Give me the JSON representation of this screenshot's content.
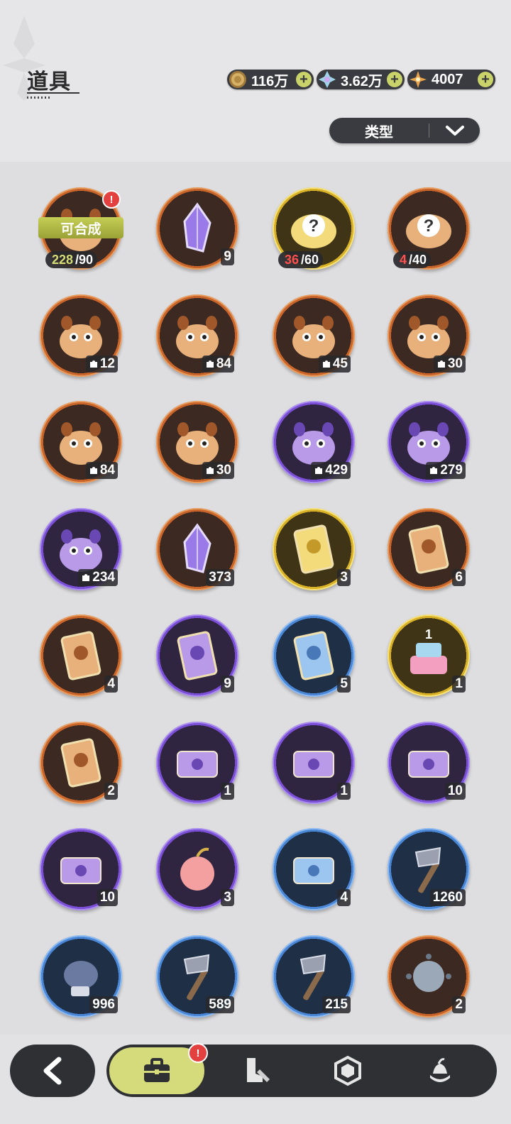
{
  "header": {
    "title": "道具",
    "currencies": [
      {
        "icon": "gold-coin-icon",
        "value": "116万"
      },
      {
        "icon": "crystal-icon",
        "value": "3.62万"
      },
      {
        "icon": "star-gem-icon",
        "value": "4007"
      }
    ],
    "plus_label": "+",
    "filter_label": "类型"
  },
  "items": [
    {
      "icon": "creature-fragment-icon",
      "rarity": "orange",
      "fragment_have": "228",
      "fragment_need": "/90",
      "have_status": "ok",
      "craft_label": "可合成",
      "alert": "!"
    },
    {
      "icon": "purple-crystal-icon",
      "rarity": "orange",
      "count": "9"
    },
    {
      "icon": "mystery-fragment-icon",
      "rarity": "gold",
      "fragment_have": "36",
      "fragment_need": "/60",
      "have_status": "low"
    },
    {
      "icon": "mystery-fragment-icon",
      "rarity": "orange",
      "fragment_have": "4",
      "fragment_need": "/40",
      "have_status": "low"
    },
    {
      "icon": "white-creature-icon",
      "rarity": "orange",
      "count": "12",
      "puzzle": true
    },
    {
      "icon": "bear-creature-icon",
      "rarity": "orange",
      "count": "84",
      "puzzle": true
    },
    {
      "icon": "knight-creature-icon",
      "rarity": "orange",
      "count": "45",
      "puzzle": true
    },
    {
      "icon": "pale-creature-icon",
      "rarity": "orange",
      "count": "30",
      "puzzle": true
    },
    {
      "icon": "red-eye-bear-icon",
      "rarity": "orange",
      "count": "84",
      "puzzle": true
    },
    {
      "icon": "lavender-creature-icon",
      "rarity": "orange",
      "count": "30",
      "puzzle": true
    },
    {
      "icon": "green-eye-creature-icon",
      "rarity": "purple",
      "count": "429",
      "puzzle": true
    },
    {
      "icon": "brown-bear-icon",
      "rarity": "purple",
      "count": "279",
      "puzzle": true
    },
    {
      "icon": "yellow-bird-icon",
      "rarity": "purple",
      "count": "234",
      "puzzle": true
    },
    {
      "icon": "star-crystal-icon",
      "rarity": "orange",
      "count": "373"
    },
    {
      "icon": "gold-card-icon",
      "rarity": "gold",
      "count": "3"
    },
    {
      "icon": "holo-card-icon",
      "rarity": "orange",
      "count": "6"
    },
    {
      "icon": "orange-card-icon",
      "rarity": "orange",
      "count": "4"
    },
    {
      "icon": "purple-card-icon",
      "rarity": "purple",
      "count": "9"
    },
    {
      "icon": "blue-card-icon",
      "rarity": "blue",
      "count": "5"
    },
    {
      "icon": "birthday-cake-icon",
      "rarity": "gold",
      "count": "1"
    },
    {
      "icon": "swap-card-icon",
      "rarity": "orange",
      "count": "2"
    },
    {
      "icon": "tea-plate-icon",
      "rarity": "purple",
      "count": "1"
    },
    {
      "icon": "gift-box-icon",
      "rarity": "purple",
      "count": "1"
    },
    {
      "icon": "golden-bag-icon",
      "rarity": "purple",
      "count": "10"
    },
    {
      "icon": "scroll-icon",
      "rarity": "purple",
      "count": "10"
    },
    {
      "icon": "apple-icon",
      "rarity": "purple",
      "count": "3"
    },
    {
      "icon": "envelope-icon",
      "rarity": "blue",
      "count": "4"
    },
    {
      "icon": "shovel-icon",
      "rarity": "blue",
      "count": "1260"
    },
    {
      "icon": "boxing-glove-icon",
      "rarity": "blue",
      "count": "996"
    },
    {
      "icon": "pickaxe-icon",
      "rarity": "blue",
      "count": "589"
    },
    {
      "icon": "hammer-icon",
      "rarity": "blue",
      "count": "215"
    },
    {
      "icon": "spiked-mine-icon",
      "rarity": "orange",
      "count": "2"
    }
  ],
  "nav": {
    "back_icon": "back-arrow-icon",
    "tabs": [
      {
        "name": "bag-tab",
        "icon": "briefcase-icon",
        "active": true
      },
      {
        "name": "equipment-tab",
        "icon": "boot-sword-icon"
      },
      {
        "name": "gem-tab",
        "icon": "hexagon-gem-icon"
      },
      {
        "name": "food-tab",
        "icon": "dessert-icon"
      }
    ],
    "alert": "!"
  },
  "colors": {
    "orange": "#c9652b",
    "purple": "#7a4fd6",
    "gold": "#d9b126",
    "blue": "#4a86d6",
    "accent": "#d5db7a",
    "dark": "#2f3034"
  }
}
